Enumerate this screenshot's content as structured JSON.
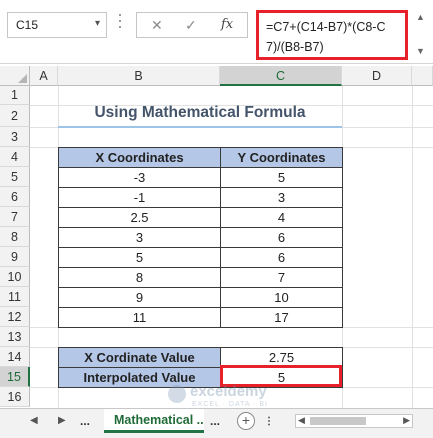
{
  "formula_bar": {
    "name_box": "C15",
    "name_caret": "▾",
    "cancel_icon": "✕",
    "enter_icon": "✓",
    "fx_label": "fx",
    "formula": "=C7+(C14-B7)*(C8-C7)/(B8-B7)"
  },
  "columns": [
    "A",
    "B",
    "C",
    "D"
  ],
  "rows": [
    "1",
    "2",
    "3",
    "4",
    "5",
    "6",
    "7",
    "8",
    "9",
    "10",
    "11",
    "12",
    "13",
    "14",
    "15",
    "16"
  ],
  "selected_cell": "C15",
  "title": "Using Mathematical Formula",
  "table": {
    "headers": [
      "X Coordinates",
      "Y Coordinates"
    ],
    "rows": [
      [
        "-3",
        "5"
      ],
      [
        "-1",
        "3"
      ],
      [
        "2.5",
        "4"
      ],
      [
        "3",
        "6"
      ],
      [
        "5",
        "6"
      ],
      [
        "8",
        "7"
      ],
      [
        "9",
        "10"
      ],
      [
        "11",
        "17"
      ]
    ]
  },
  "result": {
    "x_label": "X Cordinate Value",
    "x_value": "2.75",
    "y_label": "Interpolated Value",
    "y_value": "5"
  },
  "watermark": {
    "name": "exceldemy",
    "tagline": "EXCEL · DATA · BI"
  },
  "sheet_tabs": {
    "prev_icon": "◀",
    "next_icon": "▶",
    "ellipsis_left": "...",
    "active_tab": "Mathematical ...",
    "ellipsis_right": "...",
    "add_icon": "+"
  },
  "colors": {
    "header_fill": "#b4c7e7",
    "highlight": "#e8202a",
    "excel_green": "#217346"
  }
}
